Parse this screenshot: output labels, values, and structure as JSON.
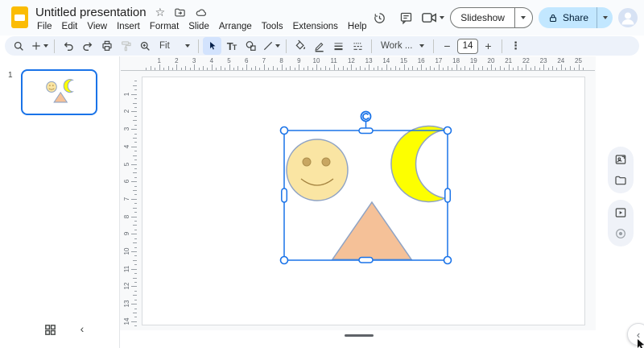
{
  "app": {
    "title": "Untitled presentation",
    "menu": [
      "File",
      "Edit",
      "View",
      "Insert",
      "Format",
      "Slide",
      "Arrange",
      "Tools",
      "Extensions",
      "Help"
    ]
  },
  "header": {
    "star_icon": "☆",
    "slideshow_label": "Slideshow",
    "share_label": "Share"
  },
  "toolbar": {
    "zoom_select_label": "Fit",
    "font_family_label": "Work ...",
    "font_size_value": "14",
    "decrease_glyph": "−",
    "increase_glyph": "+",
    "more_glyph": "⋮"
  },
  "filmstrip": {
    "slide_number": "1",
    "collapse_glyph": "‹"
  },
  "panel": {
    "collapse_glyph": "‹"
  },
  "rulers": {
    "horizontal": [
      1,
      2,
      3,
      4,
      5,
      6,
      7,
      8,
      9,
      10,
      11,
      12,
      13,
      14,
      15,
      16,
      17,
      18,
      19,
      20,
      21,
      22,
      23,
      24,
      25
    ],
    "vertical": [
      1,
      2,
      3,
      4,
      5,
      6,
      7,
      8,
      9,
      10,
      11,
      12,
      13,
      14
    ]
  },
  "slide": {
    "shapes": [
      "smiley-face",
      "crescent-moon",
      "triangle"
    ],
    "selection": "group of 3 shapes selected with resize and rotate handles"
  },
  "colors": {
    "selection": "#1A73E8",
    "toolbar_bg": "#EDF2FA",
    "active_tool_bg": "#D3E3FD",
    "share_bg": "#C2E7FF",
    "share_text": "#001D35",
    "face_fill": "#FAE5A3",
    "eye_fill": "#C8A661",
    "eye_stroke": "#AD8F4C",
    "mouth_stroke": "#A3823F",
    "moon_fill": "#FDFF00",
    "triangle_fill": "#F5C198",
    "shape_stroke": "#8FA3C4"
  }
}
